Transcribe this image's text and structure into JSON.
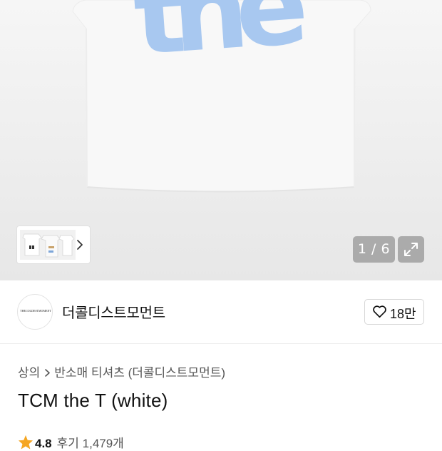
{
  "gallery": {
    "counter": "1 / 6",
    "expand_icon": "expand-icon",
    "thumb_next_icon": "chevron-right-icon",
    "print_text": "the",
    "print_color": "#a8c8f0"
  },
  "brand": {
    "name": "더콜디스트모먼트",
    "logo_text": "THECOLDESTMOMENT",
    "likes": "18만",
    "like_icon": "heart-outline-icon"
  },
  "breadcrumb": {
    "category": "상의",
    "subcategory": "반소매 티셔츠 (더콜디스트모먼트)"
  },
  "product": {
    "title": "TCM the T (white)",
    "rating": "4.8",
    "reviews": "후기 1,479개",
    "star_color": "#f5a623"
  }
}
